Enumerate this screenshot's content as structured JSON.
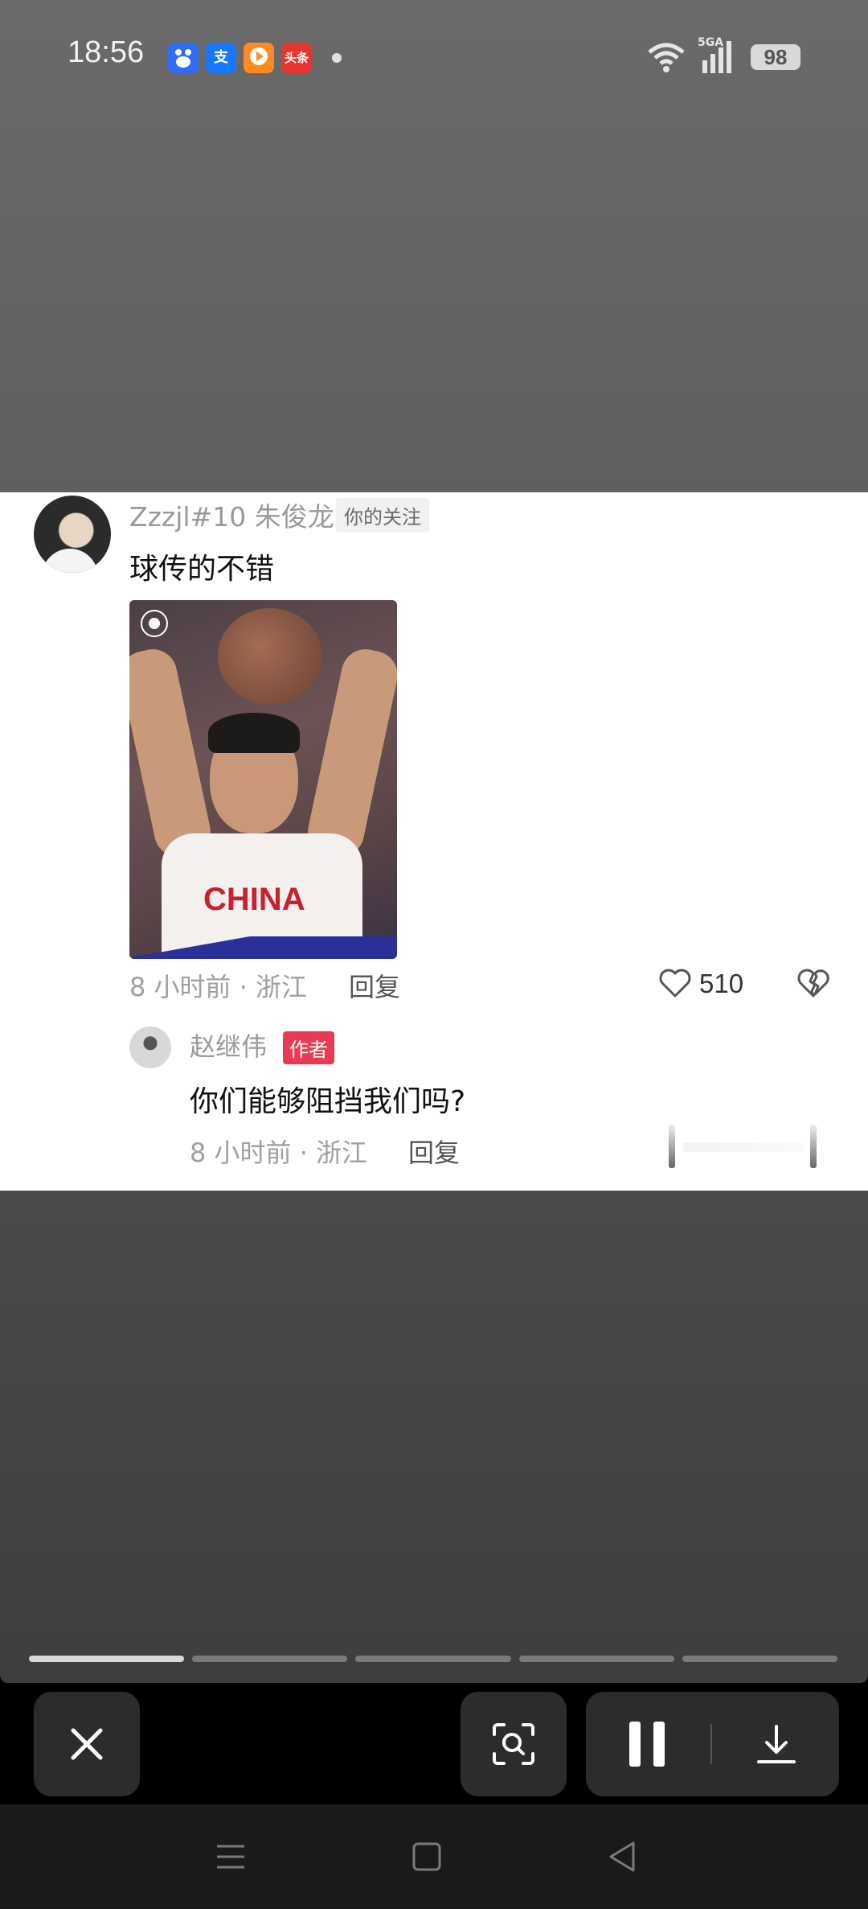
{
  "status_bar": {
    "time": "18:56",
    "apps": [
      {
        "name": "baidu-app-icon",
        "label": "",
        "color": "#2f6df6"
      },
      {
        "name": "alipay-app-icon",
        "label": "支",
        "color": "#1677ff"
      },
      {
        "name": "video-app-icon",
        "label": "",
        "color": "#ff8a1f"
      },
      {
        "name": "toutiao-app-icon",
        "label": "头条",
        "color": "#e8352f"
      }
    ],
    "network": "5GA",
    "battery": "98"
  },
  "comment": {
    "username": "Zzzjl#10 朱俊龙",
    "follow_tag": "你的关注",
    "text": "球传的不错",
    "photo_jersey_text": "CHINA",
    "meta": "8 小时前 · 浙江",
    "reply_label": "回复",
    "likes": "510"
  },
  "reply": {
    "username": "赵继伟",
    "author_tag": "作者",
    "text": "你们能够阻挡我们吗?",
    "meta": "8 小时前 · 浙江",
    "reply_label": "回复"
  },
  "progress": {
    "segments": 5,
    "active_index": 0
  },
  "controls": {
    "close": "close-icon",
    "lens": "image-search-icon",
    "pause": "pause-icon",
    "download": "download-icon"
  },
  "colors": {
    "author_tag": "#e83a52",
    "card_bg": "#ffffff",
    "control_bg": "#2c2c2c"
  }
}
